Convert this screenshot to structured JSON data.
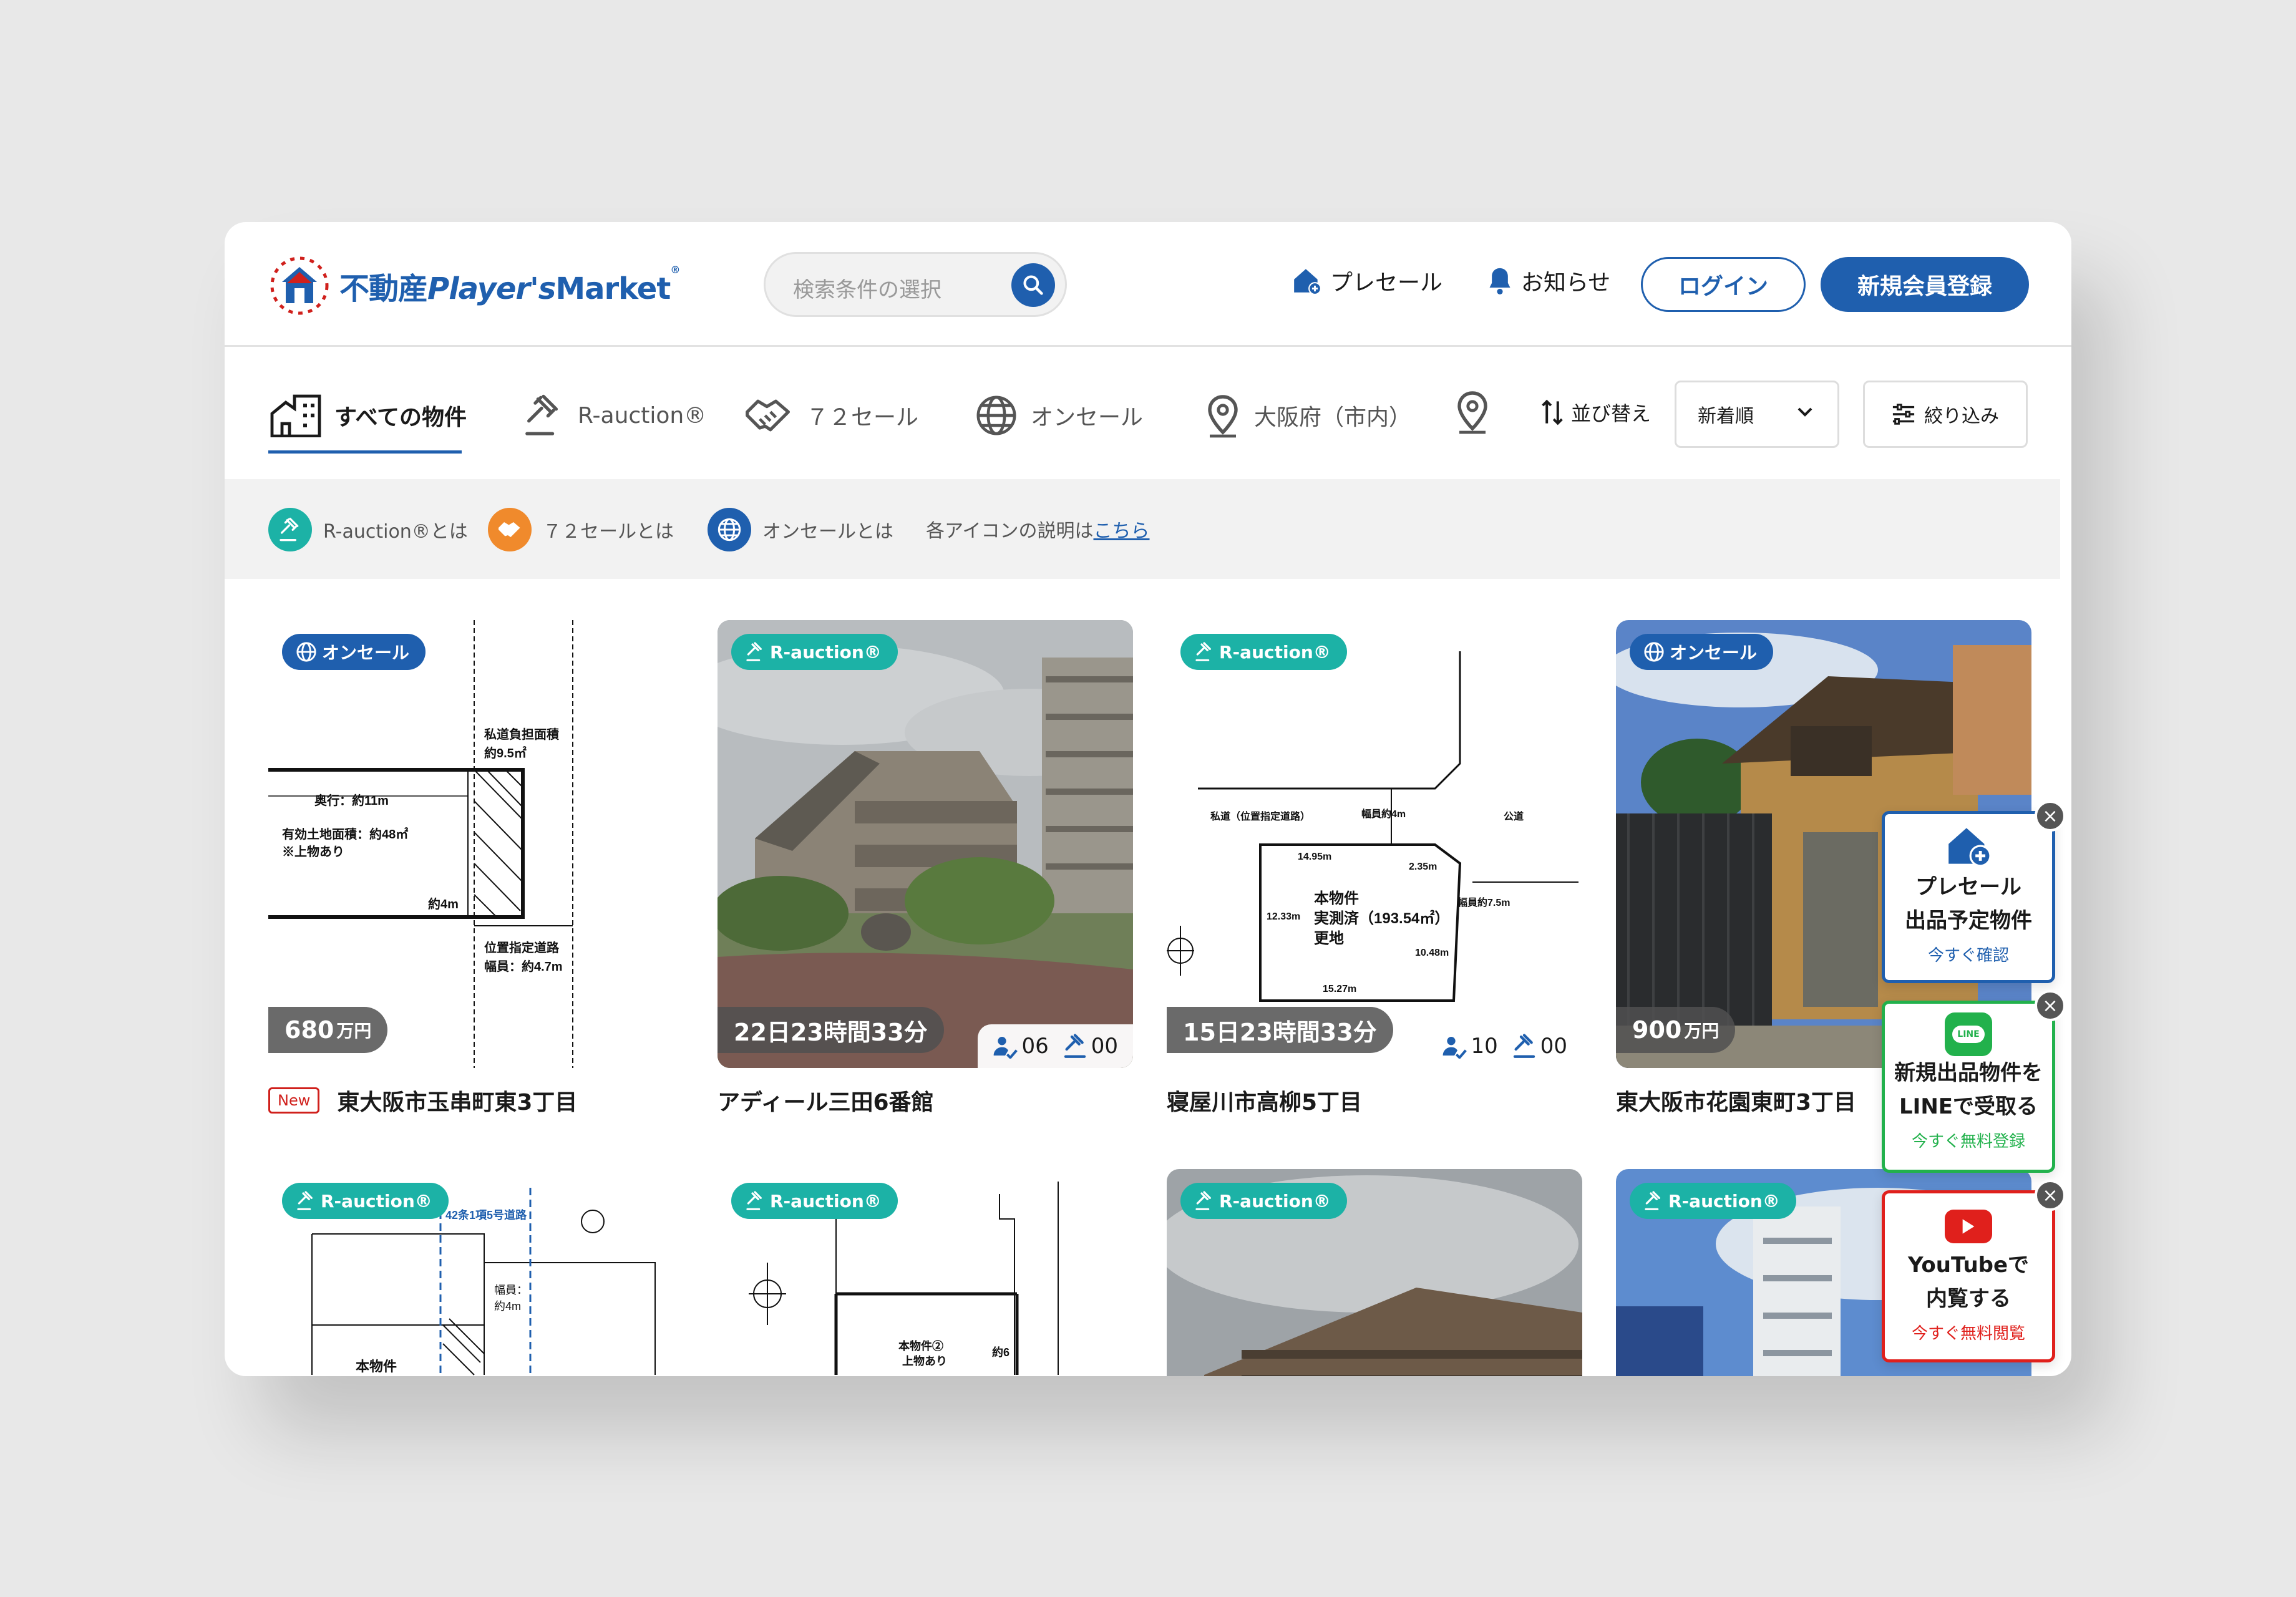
{
  "header": {
    "logo_text": "不動産",
    "logo_text2": "Player's",
    "logo_text3": "Market",
    "search_placeholder": "検索条件の選択",
    "presale": "プレセール",
    "notice": "お知らせ",
    "login": "ログイン",
    "register": "新規会員登録"
  },
  "tabs": {
    "all": "すべての物件",
    "rauction": "R-auction®",
    "sale72": "７２セール",
    "onsale": "オンセール",
    "area": "大阪府（市内）",
    "sort_label": "並び替え",
    "sort_value": "新着順",
    "filter": "絞り込み"
  },
  "legend": {
    "rauction": "R-auction®とは",
    "sale72": "７２セールとは",
    "onsale": "オンセールとは",
    "icon_explain": "各アイコンの説明は",
    "link": "こちら"
  },
  "cards": [
    {
      "badge": "オンセール",
      "price": "680",
      "unit": "万円",
      "new": "New",
      "title": "東大阪市玉串町東3丁目",
      "plan": {
        "a": "私道負担面積",
        "b": "約9.5㎡",
        "c": "奥行：約11m",
        "d": "有効土地面積：約48㎡",
        "e": "※上物あり",
        "f": "約4m",
        "g": "位置指定道路",
        "h": "幅員：約4.7m"
      }
    },
    {
      "badge": "R-auction®",
      "timer": "22日23時間33分",
      "bidders": "06",
      "bids": "00",
      "title": "アディール三田6番館"
    },
    {
      "badge": "R-auction®",
      "timer": "15日23時間33分",
      "bidders": "10",
      "bids": "00",
      "title": "寝屋川市高柳5丁目",
      "plan": {
        "a": "私道（位置指定道路）",
        "b": "幅員約4m",
        "c": "公道",
        "d": "14.95m",
        "e": "2.35m",
        "f": "本物件",
        "g": "実測済（193.54㎡）",
        "h": "更地",
        "i": "12.33m",
        "j": "10.48m",
        "k": "15.27m",
        "l": "幅員約7.5m"
      }
    },
    {
      "badge": "オンセール",
      "price": "900",
      "unit": "万円",
      "title": "東大阪市花園東町3丁目"
    },
    {
      "badge": "R-auction®",
      "plan": {
        "a": "42条1項5号道路",
        "b": "幅員：",
        "c": "約4m",
        "d": "本物件"
      }
    },
    {
      "badge": "R-auction®",
      "plan": {
        "a": "本物件②",
        "b": "上物あり",
        "c": "約6"
      }
    },
    {
      "badge": "R-auction®"
    },
    {
      "badge": "R-auction®"
    }
  ],
  "side": {
    "presale_line1": "プレセール",
    "presale_line2": "出品予定物件",
    "presale_sub": "今すぐ確認",
    "line_line1": "新規出品物件を",
    "line_line2": "LINEで受取る",
    "line_sub": "今すぐ無料登録",
    "line_icon": "LINE",
    "yt_line1": "YouTubeで",
    "yt_line2": "内覧する",
    "yt_sub": "今すぐ無料閲覧"
  },
  "colors": {
    "brand": "#1f5fae",
    "rauction": "#1cb2a6",
    "sale72": "#f08a2c",
    "line": "#22b14c",
    "youtube": "#e0201c"
  }
}
